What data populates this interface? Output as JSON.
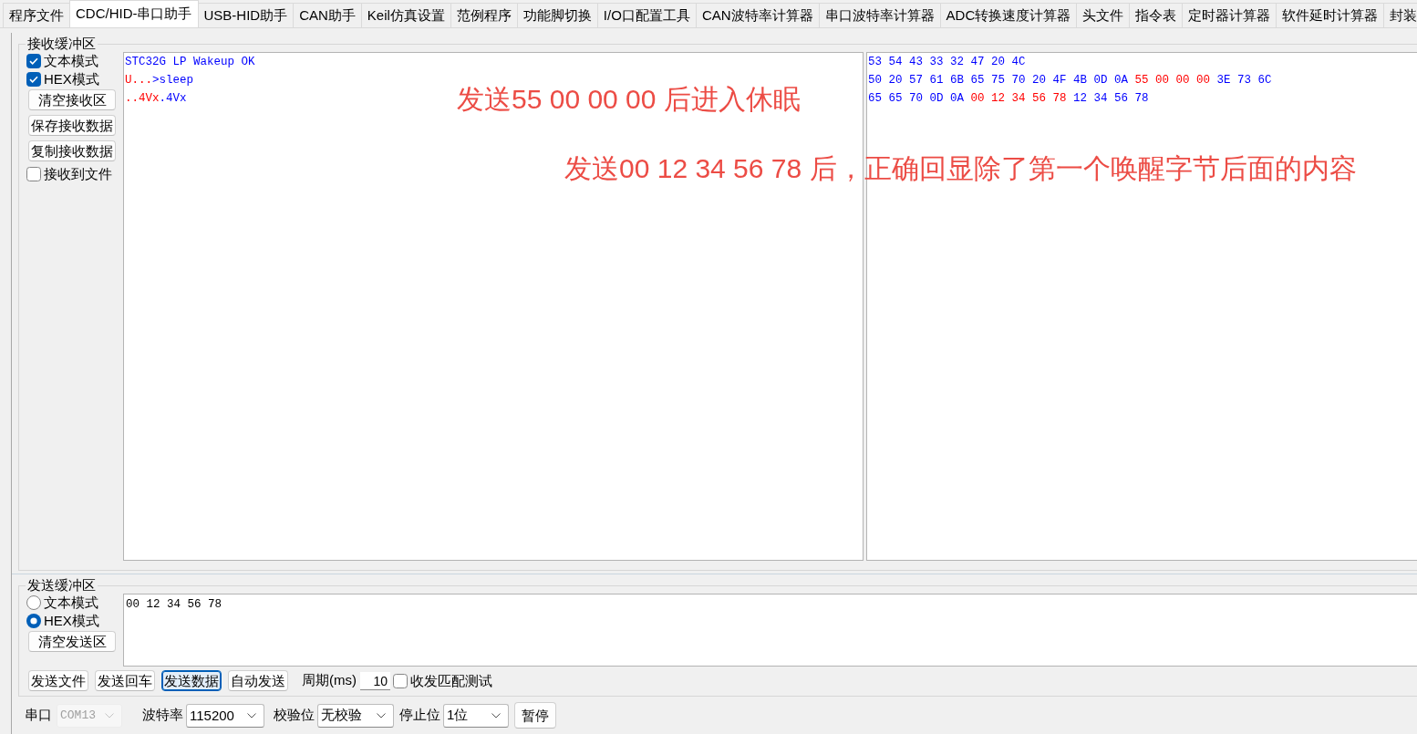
{
  "tabs": [
    {
      "label": "程序文件",
      "selected": false
    },
    {
      "label": "CDC/HID-串口助手",
      "selected": true
    },
    {
      "label": "USB-HID助手",
      "selected": false
    },
    {
      "label": "CAN助手",
      "selected": false
    },
    {
      "label": "Keil仿真设置",
      "selected": false
    },
    {
      "label": "范例程序",
      "selected": false
    },
    {
      "label": "功能脚切换",
      "selected": false
    },
    {
      "label": "I/O口配置工具",
      "selected": false
    },
    {
      "label": "CAN波特率计算器",
      "selected": false
    },
    {
      "label": "串口波特率计算器",
      "selected": false
    },
    {
      "label": "ADC转换速度计算器",
      "selected": false
    },
    {
      "label": "头文件",
      "selected": false
    },
    {
      "label": "指令表",
      "selected": false
    },
    {
      "label": "定时器计算器",
      "selected": false
    },
    {
      "label": "软件延时计算器",
      "selected": false
    },
    {
      "label": "封装",
      "selected": false
    }
  ],
  "receive_buffer": {
    "title": "接收缓冲区",
    "options": [
      {
        "kind": "checkbox",
        "label": "文本模式",
        "checked": true
      },
      {
        "kind": "checkbox",
        "label": "HEX模式",
        "checked": true
      },
      {
        "kind": "button",
        "label": "清空接收区"
      },
      {
        "kind": "button",
        "label": "保存接收数据"
      },
      {
        "kind": "button",
        "label": "复制接收数据"
      },
      {
        "kind": "checkbox",
        "label": "接收到文件",
        "checked": false
      }
    ],
    "text_view": {
      "lines": [
        {
          "segments": [
            {
              "text": "STC32G LP Wakeup OK",
              "color": "#0000ff"
            }
          ]
        },
        {
          "segments": [
            {
              "text": "U...",
              "color": "#ff0000"
            },
            {
              "text": ">sleep",
              "color": "#0000ff"
            }
          ]
        },
        {
          "segments": [
            {
              "text": "..4Vx",
              "color": "#ff0000"
            },
            {
              "text": ".4Vx",
              "color": "#0000ff"
            }
          ]
        }
      ]
    },
    "hex_view": {
      "lines": [
        {
          "segments": [
            {
              "text": "53 54 43 33 32 47 20 4C",
              "color": "#0000ff"
            }
          ]
        },
        {
          "segments": [
            {
              "text": "50 20 57 61 6B 65 75 70 20 4F 4B 0D 0A",
              "color": "#0000ff"
            },
            {
              "text": "55 00 00 00",
              "color": "#ff0000"
            },
            {
              "text": "3E 73 6C",
              "color": "#0000ff"
            }
          ]
        },
        {
          "segments": [
            {
              "text": "65 65 70 0D 0A",
              "color": "#0000ff"
            },
            {
              "text": "00 12 34 56 78",
              "color": "#ff0000"
            },
            {
              "text": "12 34 56 78",
              "color": "#0000ff"
            }
          ]
        }
      ]
    }
  },
  "annotations": [
    {
      "text": "发送55 00 00 00 后进入休眠"
    },
    {
      "text": "发送00 12 34 56 78 后，正确回显除了第一个唤醒字节后面的内容"
    }
  ],
  "send_buffer": {
    "title": "发送缓冲区",
    "modes": [
      {
        "label": "文本模式",
        "selected": false
      },
      {
        "label": "HEX模式",
        "selected": true
      }
    ],
    "clear_button": "清空发送区",
    "text": "00 12 34 56 78"
  },
  "send_actions": {
    "buttons": [
      {
        "label": "发送文件",
        "focused": false
      },
      {
        "label": "发送回车",
        "focused": false
      },
      {
        "label": "发送数据",
        "focused": true
      },
      {
        "label": "自动发送",
        "focused": false
      }
    ],
    "period_label": "周期(ms)",
    "period_value": "10",
    "match_test": {
      "label": "收发匹配测试",
      "checked": false
    }
  },
  "port_settings": [
    {
      "label": "串口",
      "value": "COM13",
      "disabled": true
    },
    {
      "label": "波特率",
      "value": "115200",
      "disabled": false
    },
    {
      "label": "校验位",
      "value": "无校验",
      "disabled": false
    },
    {
      "label": "停止位",
      "value": "1位",
      "disabled": false
    }
  ],
  "pause_button": "暂停"
}
